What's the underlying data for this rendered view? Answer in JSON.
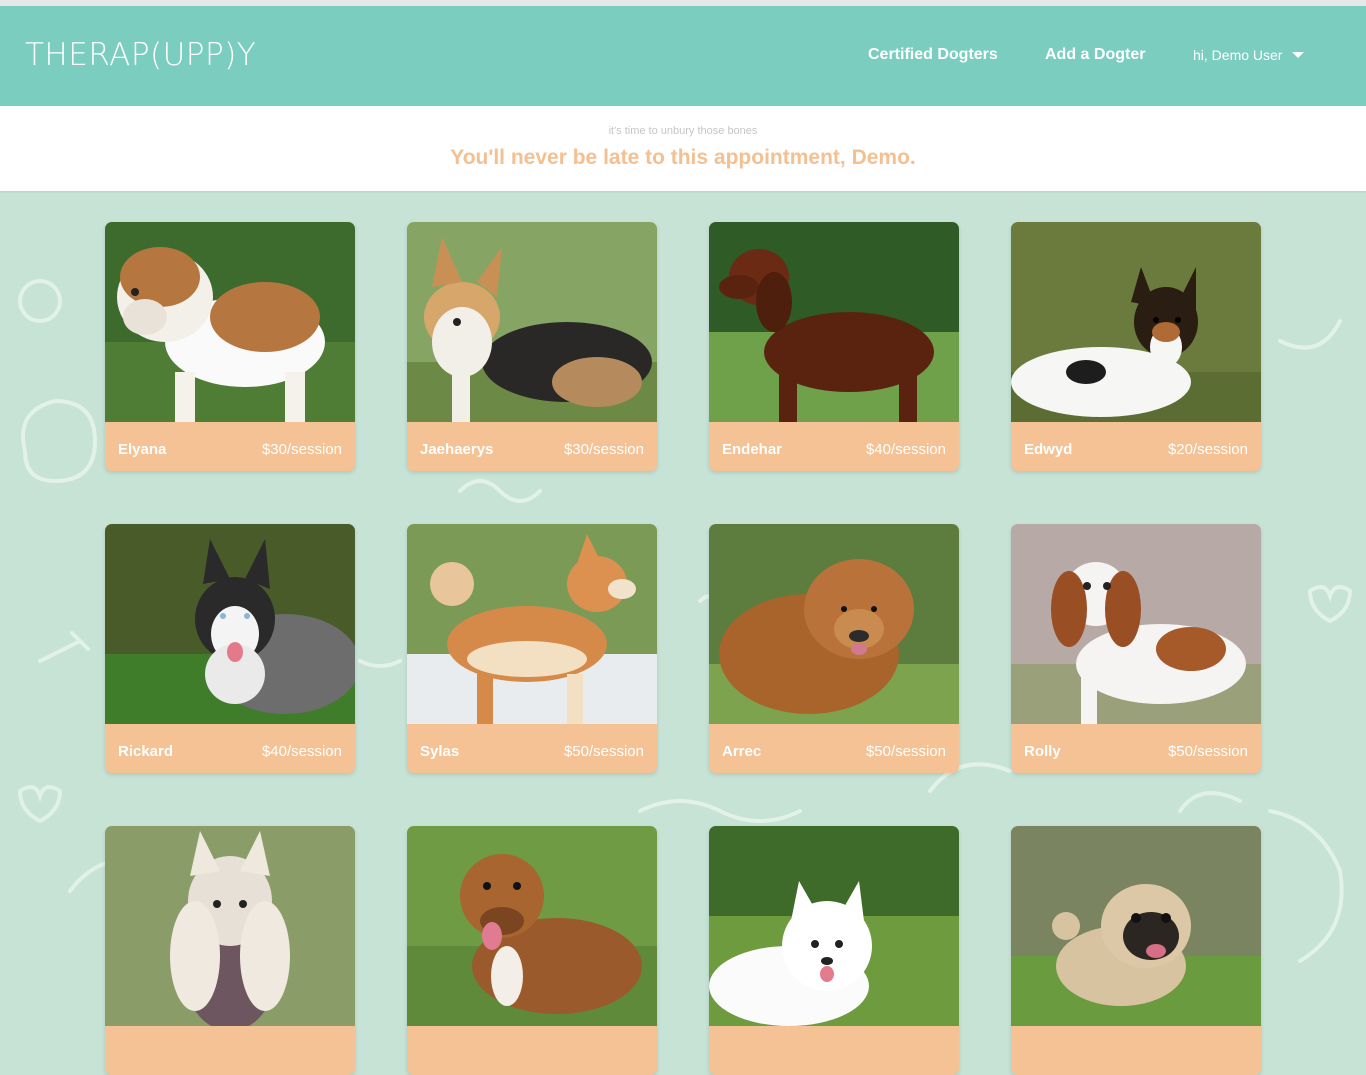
{
  "header": {
    "logo": "THERAP(UPP)Y",
    "nav": {
      "certified": "Certified Dogters",
      "add": "Add a Dogter"
    },
    "user_greeting": "hi, Demo User",
    "user_menu_icon": "caret-down-icon"
  },
  "banner": {
    "tagline": "it's time to unbury those bones",
    "welcome": "You'll never be late to this appointment, Demo."
  },
  "colors": {
    "header_bg": "#7bcdbf",
    "page_bg": "#c7e3d6",
    "card_footer": "#f4c294",
    "welcome_text": "#f4c092"
  },
  "dogs": [
    {
      "name": "Elyana",
      "price": "$30/session",
      "icon": "bulldog-photo"
    },
    {
      "name": "Jaehaerys",
      "price": "$30/session",
      "icon": "corgi-photo"
    },
    {
      "name": "Endehar",
      "price": "$40/session",
      "icon": "setter-photo"
    },
    {
      "name": "Edwyd",
      "price": "$20/session",
      "icon": "terrier-photo"
    },
    {
      "name": "Rickard",
      "price": "$40/session",
      "icon": "husky-photo"
    },
    {
      "name": "Sylas",
      "price": "$50/session",
      "icon": "akita-photo"
    },
    {
      "name": "Arrec",
      "price": "$50/session",
      "icon": "chow-photo"
    },
    {
      "name": "Rolly",
      "price": "$50/session",
      "icon": "spaniel-photo"
    },
    {
      "name": "",
      "price": "",
      "icon": "crested-photo"
    },
    {
      "name": "",
      "price": "",
      "icon": "staffie-photo"
    },
    {
      "name": "",
      "price": "",
      "icon": "samoyed-photo"
    },
    {
      "name": "",
      "price": "",
      "icon": "pug-photo"
    }
  ]
}
